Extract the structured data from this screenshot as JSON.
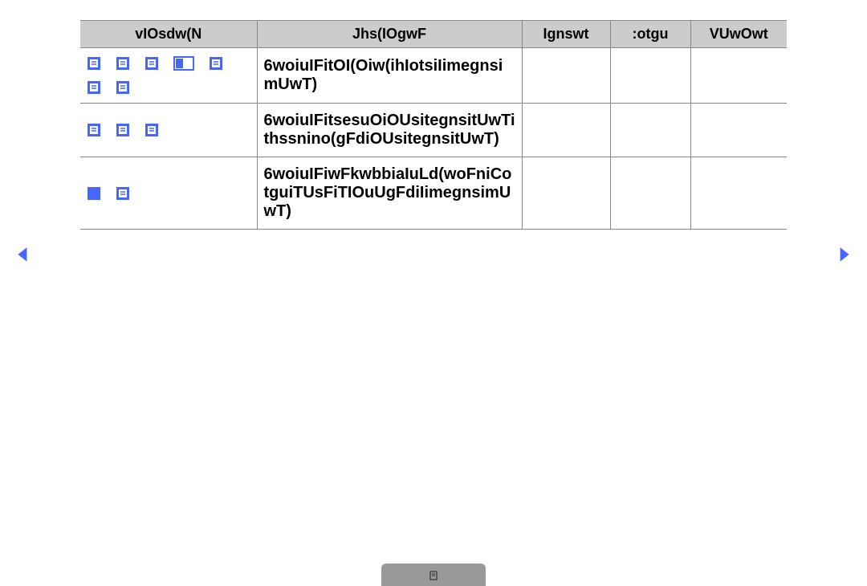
{
  "colors": {
    "icon_blue": "#4766ff",
    "header_bg": "#cccccc"
  },
  "table": {
    "headers": [
      "vIOsdw(N",
      "Jhs(IOgwF",
      "Ignswt",
      ":otgu",
      "VUwOwt"
    ],
    "rows": [
      {
        "icons": [
          "doc-icon",
          "doc-icon",
          "doc-icon",
          "page-icon",
          "doc-icon",
          "doc-icon",
          "doc-icon"
        ],
        "title": "6woiuIFitOI(Oiw(ihIotsiIimegnsimUwT)",
        "c3": "",
        "c4": "",
        "c5": ""
      },
      {
        "icons": [
          "doc-icon",
          "doc-icon",
          "doc-icon"
        ],
        "title": "6woiuIFitsesuOiOUsitegnsitUwTithssnino(gFdiOUsitegnsitUwT)",
        "c3": "",
        "c4": "",
        "c5": ""
      },
      {
        "icons": [
          "square-icon",
          "doc-icon"
        ],
        "title": "6woiuIFiwFkwbbiaIuLd(woFniCotguiTUsFiTIOuUgFdiIimegnsimUwT)",
        "c3": "",
        "c4": "",
        "c5": ""
      }
    ]
  },
  "footer": {
    "label": ""
  }
}
